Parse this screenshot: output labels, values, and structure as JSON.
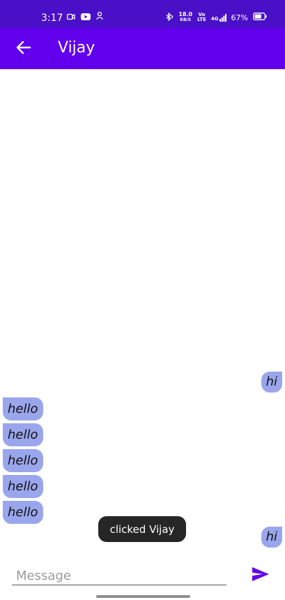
{
  "status_bar": {
    "time": "3:17",
    "net_speed_value": "18.0",
    "net_speed_unit": "KB/S",
    "volte_top": "Vo",
    "volte_bottom": "LTE",
    "signal_label": "4G",
    "battery_percent": "67%",
    "icons": [
      "screen-record-icon",
      "youtube-icon",
      "notification-icon",
      "bluetooth-icon",
      "signal-icon",
      "battery-icon"
    ]
  },
  "app_bar": {
    "back_icon": "arrow-back-icon",
    "title": "Vijay"
  },
  "messages": [
    {
      "text": "hi",
      "direction": "sent"
    },
    {
      "text": "hello",
      "direction": "received"
    },
    {
      "text": "hello",
      "direction": "received"
    },
    {
      "text": "hello",
      "direction": "received"
    },
    {
      "text": "hello",
      "direction": "received"
    },
    {
      "text": "hello",
      "direction": "received"
    },
    {
      "text": "hi",
      "direction": "sent"
    }
  ],
  "toast": {
    "text": "clicked Vijay"
  },
  "composer": {
    "placeholder": "Message",
    "value": "",
    "send_icon": "send-icon"
  },
  "colors": {
    "status_bar": "#4a10c8",
    "app_bar": "#6200ee",
    "bubble": "#9aa6ec",
    "send_icon": "#6200ee",
    "toast_bg": "#262626"
  }
}
